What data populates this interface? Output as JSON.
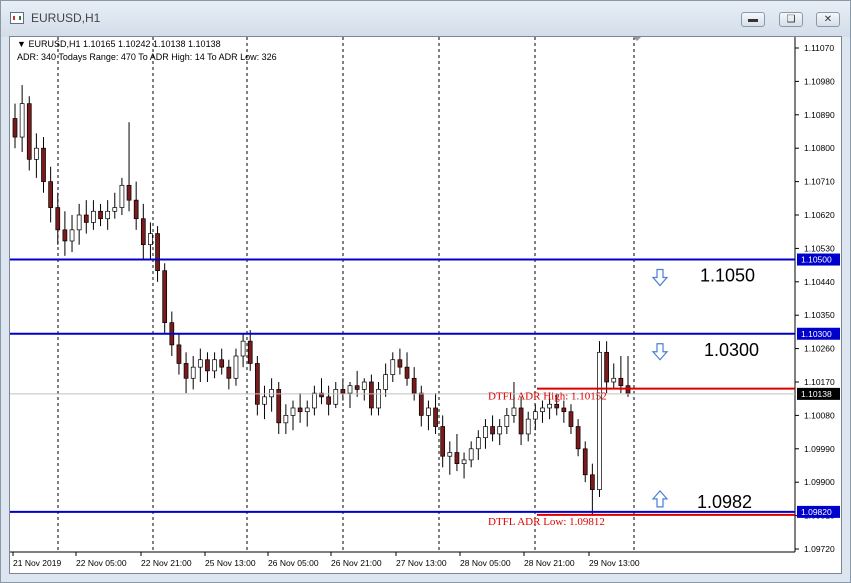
{
  "window": {
    "title": "EURUSD,H1",
    "minimize_icon": "minimize-icon",
    "restore_icon": "restore-icon",
    "close_icon": "close-icon"
  },
  "chart": {
    "header_line1": "EURUSD,H1  1.10165 1.10242 1.10138 1.10138",
    "header_line2": "ADR: 340  Todays Range: 470  To ADR High: 14  To ADR Low: 326",
    "current_price_label": "1.10138",
    "colors": {
      "bull": "#ffffff",
      "bear": "#7a1a1a",
      "wick": "#000000",
      "level_line": "#0000cc",
      "adr_line": "#dd0000",
      "arrow": "#4a7fd4"
    }
  },
  "chart_data": {
    "type": "candlestick",
    "y_ticks": [
      "1.11070",
      "1.10980",
      "1.10890",
      "1.10800",
      "1.10710",
      "1.10620",
      "1.10530",
      "1.10440",
      "1.10350",
      "1.10260",
      "1.10170",
      "1.10080",
      "1.09990",
      "1.09900",
      "1.09810",
      "1.09720"
    ],
    "ylim": [
      1.097,
      1.1112
    ],
    "x_ticks": [
      "21 Nov 2019",
      "22 Nov 05:00",
      "22 Nov 21:00",
      "25 Nov 13:00",
      "26 Nov 05:00",
      "26 Nov 21:00",
      "27 Nov 13:00",
      "28 Nov 05:00",
      "28 Nov 21:00",
      "29 Nov 13:00"
    ],
    "price_levels": [
      {
        "value": 1.105,
        "axis_label": "1.10500",
        "annotation": "1.1050",
        "arrow": "down"
      },
      {
        "value": 1.103,
        "axis_label": "1.10300",
        "annotation": "1.0300",
        "arrow": "down"
      },
      {
        "value": 1.0982,
        "axis_label": "1.09820",
        "annotation": "1.0982",
        "arrow": "up"
      }
    ],
    "adr_lines": [
      {
        "value": 1.10152,
        "label": "DTFL ADR High: 1.10152"
      },
      {
        "value": 1.09812,
        "label": "DTFL ADR Low: 1.09812"
      }
    ],
    "current_price": 1.10138,
    "candles": [
      [
        1.1088,
        1.1092,
        1.108,
        1.1083
      ],
      [
        1.1083,
        1.1097,
        1.1079,
        1.1092
      ],
      [
        1.1092,
        1.1094,
        1.1074,
        1.1077
      ],
      [
        1.1077,
        1.1084,
        1.1072,
        1.108
      ],
      [
        1.108,
        1.1083,
        1.1068,
        1.1071
      ],
      [
        1.1071,
        1.1075,
        1.106,
        1.1064
      ],
      [
        1.1064,
        1.1068,
        1.1054,
        1.1058
      ],
      [
        1.1058,
        1.1063,
        1.1051,
        1.1055
      ],
      [
        1.1055,
        1.1062,
        1.1052,
        1.1058
      ],
      [
        1.1058,
        1.1065,
        1.1054,
        1.1062
      ],
      [
        1.1062,
        1.1066,
        1.1057,
        1.106
      ],
      [
        1.106,
        1.1066,
        1.1058,
        1.1063
      ],
      [
        1.1063,
        1.1065,
        1.1059,
        1.1061
      ],
      [
        1.1061,
        1.1066,
        1.1058,
        1.1063
      ],
      [
        1.1063,
        1.1068,
        1.1061,
        1.1064
      ],
      [
        1.1064,
        1.1072,
        1.1062,
        1.107
      ],
      [
        1.107,
        1.1087,
        1.1063,
        1.1066
      ],
      [
        1.1066,
        1.1071,
        1.1058,
        1.1061
      ],
      [
        1.1061,
        1.1065,
        1.105,
        1.1054
      ],
      [
        1.1054,
        1.106,
        1.105,
        1.1057
      ],
      [
        1.1057,
        1.1059,
        1.1044,
        1.1047
      ],
      [
        1.1047,
        1.1049,
        1.103,
        1.1033
      ],
      [
        1.1033,
        1.1036,
        1.1024,
        1.1027
      ],
      [
        1.1027,
        1.103,
        1.1019,
        1.1022
      ],
      [
        1.1022,
        1.1025,
        1.1014,
        1.1018
      ],
      [
        1.1018,
        1.1024,
        1.1015,
        1.1021
      ],
      [
        1.1021,
        1.1026,
        1.1017,
        1.1023
      ],
      [
        1.1023,
        1.1025,
        1.1017,
        1.102
      ],
      [
        1.102,
        1.1025,
        1.1018,
        1.1023
      ],
      [
        1.1023,
        1.1026,
        1.1019,
        1.1021
      ],
      [
        1.1021,
        1.1023,
        1.1015,
        1.1018
      ],
      [
        1.1018,
        1.1026,
        1.1016,
        1.1024
      ],
      [
        1.1024,
        1.103,
        1.1021,
        1.1028
      ],
      [
        1.1028,
        1.1031,
        1.102,
        1.1022
      ],
      [
        1.1022,
        1.1024,
        1.1008,
        1.1011
      ],
      [
        1.1011,
        1.1016,
        1.1007,
        1.1013
      ],
      [
        1.1013,
        1.1018,
        1.1009,
        1.1015
      ],
      [
        1.1015,
        1.1017,
        1.1003,
        1.1006
      ],
      [
        1.1006,
        1.1011,
        1.1003,
        1.1008
      ],
      [
        1.1008,
        1.1012,
        1.1004,
        1.101
      ],
      [
        1.101,
        1.1014,
        1.1006,
        1.1009
      ],
      [
        1.1009,
        1.1012,
        1.1005,
        1.101
      ],
      [
        1.101,
        1.1016,
        1.1008,
        1.1014
      ],
      [
        1.1014,
        1.1018,
        1.1011,
        1.1013
      ],
      [
        1.1013,
        1.1016,
        1.1008,
        1.1011
      ],
      [
        1.1011,
        1.1017,
        1.101,
        1.1015
      ],
      [
        1.1015,
        1.1018,
        1.1012,
        1.1014
      ],
      [
        1.1014,
        1.1017,
        1.101,
        1.1016
      ],
      [
        1.1016,
        1.102,
        1.1013,
        1.1015
      ],
      [
        1.1015,
        1.1018,
        1.1012,
        1.1017
      ],
      [
        1.1017,
        1.1019,
        1.1008,
        1.101
      ],
      [
        1.101,
        1.1017,
        1.1008,
        1.1015
      ],
      [
        1.1015,
        1.1022,
        1.1013,
        1.1019
      ],
      [
        1.1019,
        1.1025,
        1.1017,
        1.1023
      ],
      [
        1.1023,
        1.1026,
        1.1019,
        1.1021
      ],
      [
        1.1021,
        1.1025,
        1.1016,
        1.1018
      ],
      [
        1.1018,
        1.1021,
        1.1012,
        1.1014
      ],
      [
        1.1014,
        1.1016,
        1.1005,
        1.1008
      ],
      [
        1.1008,
        1.1012,
        1.1004,
        1.101
      ],
      [
        1.101,
        1.1014,
        1.1003,
        1.1005
      ],
      [
        1.1005,
        1.1008,
        1.0994,
        1.0997
      ],
      [
        1.0997,
        1.1001,
        1.0992,
        1.0998
      ],
      [
        1.0998,
        1.1003,
        1.0993,
        1.0995
      ],
      [
        1.0995,
        1.0998,
        1.0991,
        1.0996
      ],
      [
        1.0996,
        1.1001,
        1.0994,
        1.0999
      ],
      [
        1.0999,
        1.1004,
        1.0996,
        1.1002
      ],
      [
        1.1002,
        1.1007,
        1.0999,
        1.1005
      ],
      [
        1.1005,
        1.1008,
        1.1001,
        1.1003
      ],
      [
        1.1003,
        1.1007,
        1.1,
        1.1005
      ],
      [
        1.1005,
        1.101,
        1.1003,
        1.1008
      ],
      [
        1.1008,
        1.1017,
        1.1006,
        1.101
      ],
      [
        1.101,
        1.1013,
        1.1,
        1.1003
      ],
      [
        1.1003,
        1.1009,
        1.1001,
        1.1007
      ],
      [
        1.1007,
        1.1011,
        1.1004,
        1.1009
      ],
      [
        1.1009,
        1.1012,
        1.1006,
        1.101
      ],
      [
        1.101,
        1.1013,
        1.1007,
        1.1011
      ],
      [
        1.1011,
        1.1014,
        1.1008,
        1.101
      ],
      [
        1.101,
        1.1012,
        1.1006,
        1.1009
      ],
      [
        1.1009,
        1.1011,
        1.1003,
        1.1005
      ],
      [
        1.1005,
        1.1007,
        1.0997,
        1.0999
      ],
      [
        1.0999,
        1.1001,
        1.099,
        1.0992
      ],
      [
        1.0992,
        1.0995,
        1.0981,
        1.0988
      ],
      [
        1.0988,
        1.1028,
        1.0986,
        1.1025
      ],
      [
        1.1025,
        1.1028,
        1.1014,
        1.1017
      ],
      [
        1.1017,
        1.1022,
        1.1015,
        1.1018
      ],
      [
        1.1018,
        1.1024,
        1.1014,
        1.1016
      ],
      [
        1.1016,
        1.1024,
        1.1013,
        1.1014
      ]
    ]
  }
}
